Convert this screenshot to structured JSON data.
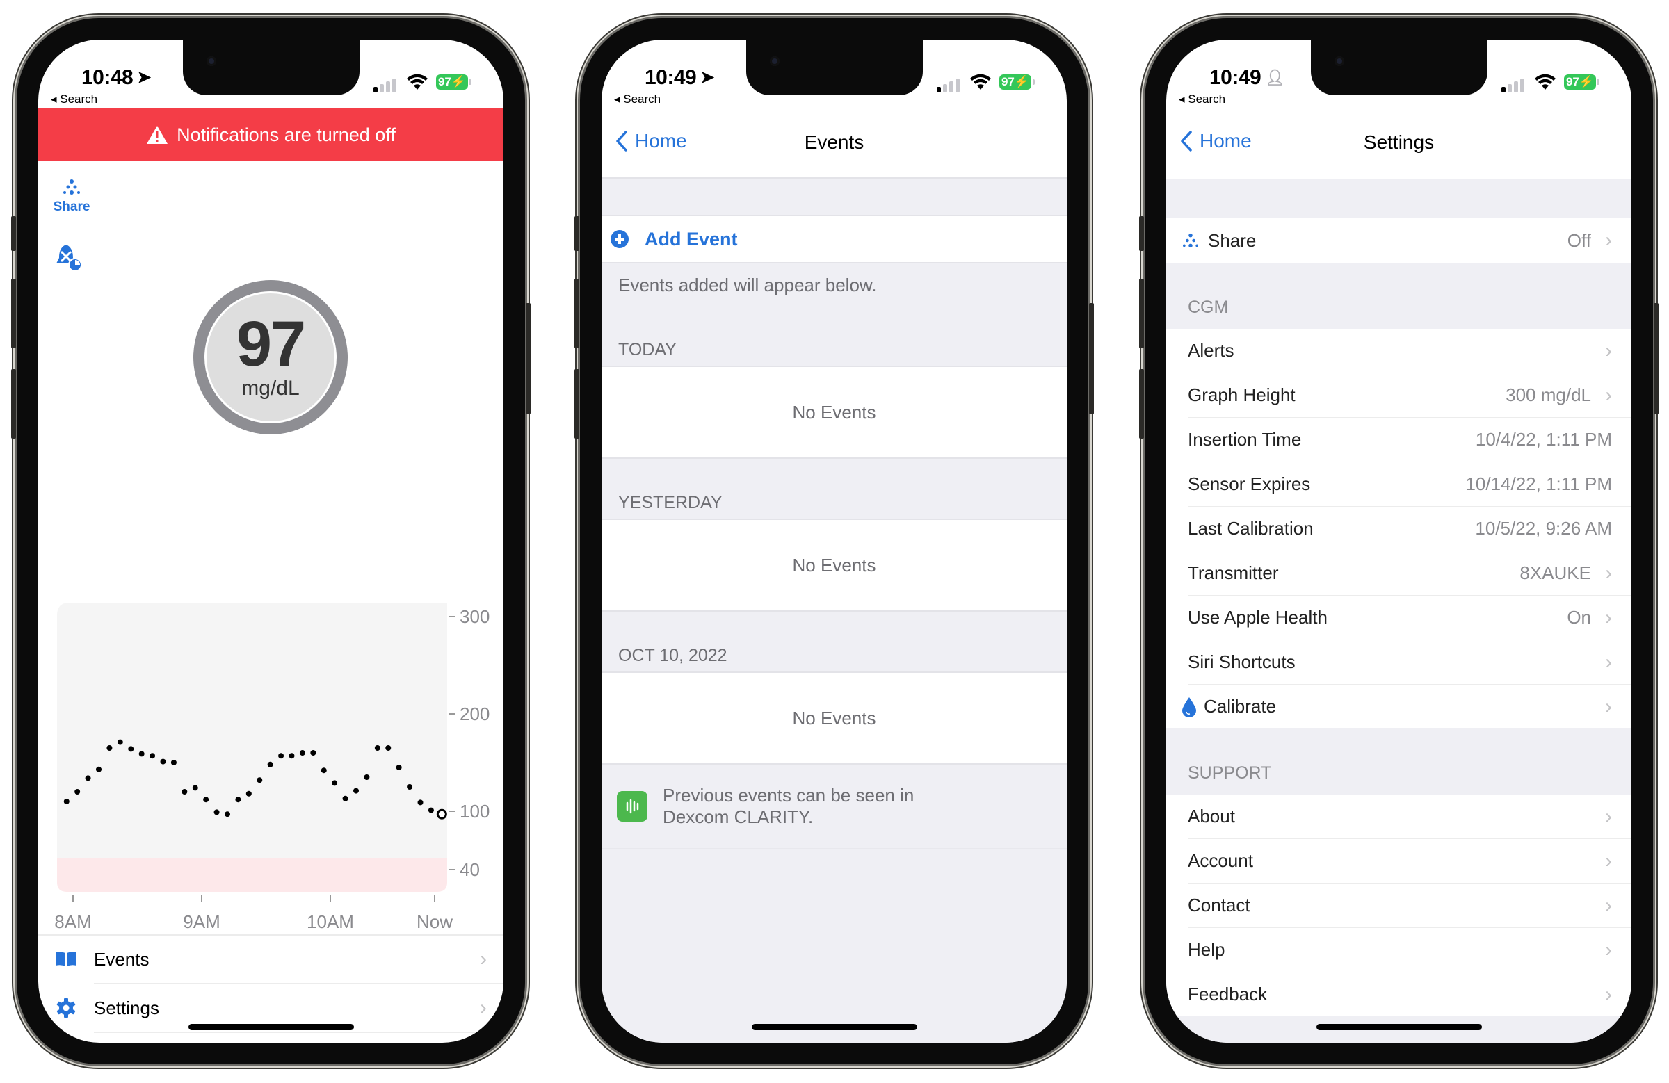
{
  "phones": {
    "home": {
      "status": {
        "time": "10:48",
        "back_app": "Search",
        "battery": "97"
      },
      "banner": {
        "text": "Notifications are turned off"
      },
      "share_label": "Share",
      "glucose": {
        "value": "97",
        "unit": "mg/dL"
      },
      "menu": [
        {
          "label": "Events"
        },
        {
          "label": "Settings"
        }
      ]
    },
    "events": {
      "status": {
        "time": "10:49",
        "back_app": "Search",
        "battery": "97"
      },
      "nav": {
        "back": "Home",
        "title": "Events"
      },
      "add_event": "Add Event",
      "hint": "Events added will appear below.",
      "sections": [
        {
          "header": "TODAY",
          "empty": "No Events"
        },
        {
          "header": "YESTERDAY",
          "empty": "No Events"
        },
        {
          "header": "OCT 10, 2022",
          "empty": "No Events"
        }
      ],
      "clarity_note": "Previous events can be seen in Dexcom CLARITY."
    },
    "settings": {
      "status": {
        "time": "10:49",
        "back_app": "Search",
        "battery": "97"
      },
      "nav": {
        "back": "Home",
        "title": "Settings"
      },
      "share": {
        "label": "Share",
        "value": "Off"
      },
      "cgm_header": "CGM",
      "cgm_rows": [
        {
          "label": "Alerts",
          "value": "",
          "chevron": true
        },
        {
          "label": "Graph Height",
          "value": "300 mg/dL",
          "chevron": true
        },
        {
          "label": "Insertion Time",
          "value": "10/4/22, 1:11 PM",
          "chevron": false
        },
        {
          "label": "Sensor Expires",
          "value": "10/14/22, 1:11 PM",
          "chevron": false
        },
        {
          "label": "Last Calibration",
          "value": "10/5/22, 9:26 AM",
          "chevron": false
        },
        {
          "label": "Transmitter",
          "value": "8XAUKE",
          "chevron": true
        },
        {
          "label": "Use Apple Health",
          "value": "On",
          "chevron": true
        },
        {
          "label": "Siri Shortcuts",
          "value": "",
          "chevron": true
        },
        {
          "label": "Calibrate",
          "value": "",
          "chevron": true,
          "icon": "drop-icon"
        }
      ],
      "support_header": "SUPPORT",
      "support_rows": [
        {
          "label": "About"
        },
        {
          "label": "Account"
        },
        {
          "label": "Contact"
        },
        {
          "label": "Help"
        },
        {
          "label": "Feedback"
        }
      ]
    }
  },
  "colors": {
    "accent": "#2673d9",
    "alert_banner": "#f43d47",
    "battery": "#34c759",
    "low_zone": "#fde8ea",
    "chart_bg": "#f5f5f5"
  },
  "chart_data": {
    "type": "scatter",
    "title": "",
    "xlabel": "",
    "ylabel": "mg/dL",
    "x_ticks": [
      "8AM",
      "9AM",
      "10AM",
      "Now"
    ],
    "y_ticks": [
      300,
      200,
      100,
      40
    ],
    "ylim": [
      40,
      300
    ],
    "low_zone": [
      40,
      55
    ],
    "x_minutes_from_8am": [
      -3,
      2,
      7,
      12,
      17,
      22,
      27,
      32,
      37,
      42,
      47,
      52,
      57,
      62,
      67,
      72,
      77,
      82,
      87,
      92,
      97,
      102,
      107,
      112,
      117,
      122,
      127,
      132,
      137,
      142,
      147,
      152,
      157,
      162,
      167,
      172
    ],
    "values": [
      110,
      120,
      134,
      143,
      165,
      171,
      164,
      159,
      157,
      151,
      150,
      120,
      124,
      112,
      99,
      97,
      112,
      118,
      132,
      148,
      157,
      157,
      160,
      160,
      142,
      129,
      113,
      121,
      135,
      165,
      165,
      145,
      125,
      109,
      101,
      97
    ],
    "current_point_index": 35
  }
}
